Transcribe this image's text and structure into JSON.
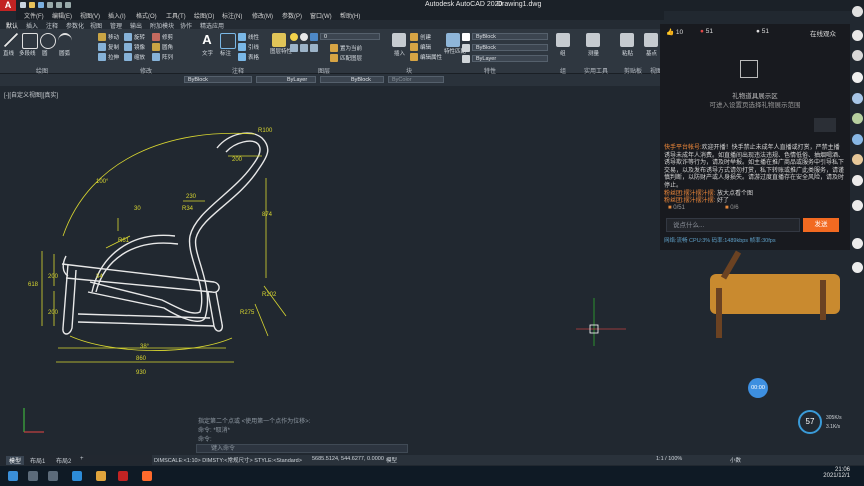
{
  "app": {
    "name": "Autodesk AutoCAD 2020",
    "document": "Drawing1.dwg"
  },
  "menu": [
    "文件(F)",
    "编辑(E)",
    "视图(V)",
    "插入(I)",
    "格式(O)",
    "工具(T)",
    "绘图(D)",
    "标注(N)",
    "修改(M)",
    "参数(P)",
    "窗口(W)",
    "帮助(H)"
  ],
  "ribbon_tabs": [
    "默认",
    "插入",
    "注释",
    "参数化",
    "视图",
    "管理",
    "输出",
    "附加模块",
    "协作",
    "精选应用"
  ],
  "ribbon_groups": [
    "绘图",
    "修改",
    "注释",
    "图层",
    "块",
    "特性",
    "组",
    "实用工具",
    "剪贴板",
    "视图"
  ],
  "ribbon_buttons": {
    "line": "直线",
    "polyline": "多段线",
    "circle": "圆",
    "arc": "圆弧",
    "move": "移动",
    "rotate": "旋转",
    "trim": "修剪",
    "copy": "复制",
    "mirror": "镜像",
    "fillet": "圆角",
    "stretch": "拉伸",
    "scale": "缩放",
    "array": "阵列",
    "text": "文字",
    "dimension": "标注",
    "linear": "线性",
    "leader": "引线",
    "table": "表格",
    "layer_props": "图层特性",
    "make_current": "置为当前",
    "match_layer": "匹配图层",
    "insert": "插入",
    "create": "创建",
    "edit": "编辑",
    "edit_attr": "编辑属性",
    "match_props": "特性匹配",
    "group": "组",
    "measure": "测量",
    "paste": "粘贴",
    "base": "基点",
    "layer_value": "0"
  },
  "props": {
    "color": "ByBlock",
    "linetype": "ByLayer",
    "lineweight": "ByBlock",
    "plotstyle": "ByColor",
    "r_color": "ByBlock",
    "r_linetype": "ByBlock",
    "r_lineweight": "ByLayer"
  },
  "viewport_label": "[-][自定义视图][真实]",
  "dimensions": {
    "d100": "100°",
    "d200": "200",
    "d874": "874",
    "d618": "618",
    "d200b": "200",
    "d200c": "200",
    "d860": "860",
    "d930": "930",
    "d38": "38°",
    "d34": "34",
    "d30": "30",
    "r100": "R100",
    "r34": "R34",
    "r61": "R61",
    "r202": "R202",
    "r275": "R275",
    "d230": "230"
  },
  "command": {
    "line1": "指定第二个点或 <使用第一个点作为位移>:",
    "line2": "命令: *取消*",
    "line3": "命令:",
    "prompt": "键入命令"
  },
  "layout_tabs": [
    "模型",
    "布局1",
    "布局2",
    "+"
  ],
  "status": {
    "text": "DIMSCALE:<1:10> DIMSTY:<常规尺寸> STYLE:<Standard>",
    "coords": "5685.5124, 544.6277, 0.0000",
    "model": "模型",
    "scale": "1:1 / 100%",
    "units": "小数"
  },
  "clock": {
    "time": "21:06",
    "date": "2021/12/1"
  },
  "stream": {
    "likes": "10",
    "hearts": "51",
    "viewers": "51",
    "online_link": "在线观众",
    "gift_title": "礼物道具展示区",
    "gift_sub": "可进入设置页选择礼物展示范围",
    "chat": [
      {
        "name": "快手平台帐号:",
        "text": "欢迎开播！快手禁止未成年人直播或打赏，严禁主播诱导未成年人消费。如直播间出现违法违规、色情低俗、抽烟喝酒、诱导欺诈等行为，请及时举报。如主播在推广商品或服务中引导私下交易，以及发布诱导方式请勿打赏，私下转账或推广此类服务，请谨慎判断，以防财产或人身损失。请游过度直播存在安全风险，请及时停止。"
      },
      {
        "name": "粉丝团:",
        "user": "摆汁摆汁摆:",
        "text": "放大点看个图"
      },
      {
        "name": "粉丝团:",
        "user": "摆汁摆汁摆:",
        "text": "好了"
      }
    ],
    "counter1": "0/51",
    "counter2": "0/6",
    "input_placeholder": "说点什么...",
    "send": "发送",
    "stats": "网络:流畅    CPU:3%    码率:1489kbps    帧率:30fps",
    "timer": "00:00",
    "percent": "57",
    "up": "305K/s",
    "down": "3.1K/s"
  }
}
